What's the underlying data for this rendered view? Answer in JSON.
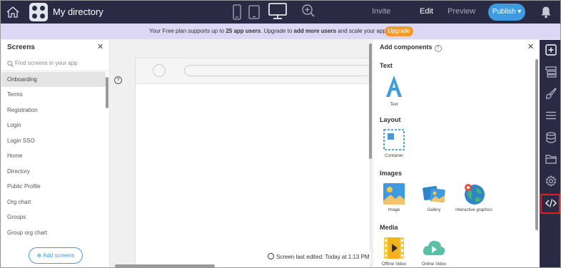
{
  "topbar": {
    "app_title": "My directory",
    "invite_label": "Invite",
    "edit_label": "Edit",
    "preview_label": "Preview",
    "publish_label": "Publish ▾"
  },
  "banner": {
    "text_before": "Your Free plan supports up to ",
    "text_bold1": "25 app users",
    "text_middle": ". Upgrade to ",
    "text_bold2": "add more users",
    "text_after": " and scale your app.",
    "upgrade_label": "Upgrade"
  },
  "screens_panel": {
    "title": "Screens",
    "search_placeholder": "Find screens in your app",
    "items": [
      {
        "label": "Onboarding"
      },
      {
        "label": "Terms"
      },
      {
        "label": "Registration"
      },
      {
        "label": "Login"
      },
      {
        "label": "Login SSO"
      },
      {
        "label": "Home"
      },
      {
        "label": "Directory"
      },
      {
        "label": "Public Profile"
      },
      {
        "label": "Org chart"
      },
      {
        "label": "Groups"
      },
      {
        "label": "Group org chart"
      }
    ],
    "add_label": "Add screens"
  },
  "canvas": {
    "help": "?",
    "last_edited": "Screen last edited: Today at 1:13 PM"
  },
  "components_panel": {
    "title": "Add components",
    "help": "?",
    "sections": {
      "text": "Text",
      "layout": "Layout",
      "images": "Images",
      "media": "Media"
    },
    "items": {
      "text": "Text",
      "container": "Container",
      "image": "Image",
      "gallery": "Gallery",
      "interactive": "Interactive graphics",
      "offline_video": "Offline Video",
      "online_video": "Online Video"
    }
  },
  "colors": {
    "topbar": "#2b2a45",
    "banner": "#dcd7f5",
    "accent": "#3f9be0",
    "upgrade": "#f29b2a",
    "selected_outline": "#e02020"
  }
}
